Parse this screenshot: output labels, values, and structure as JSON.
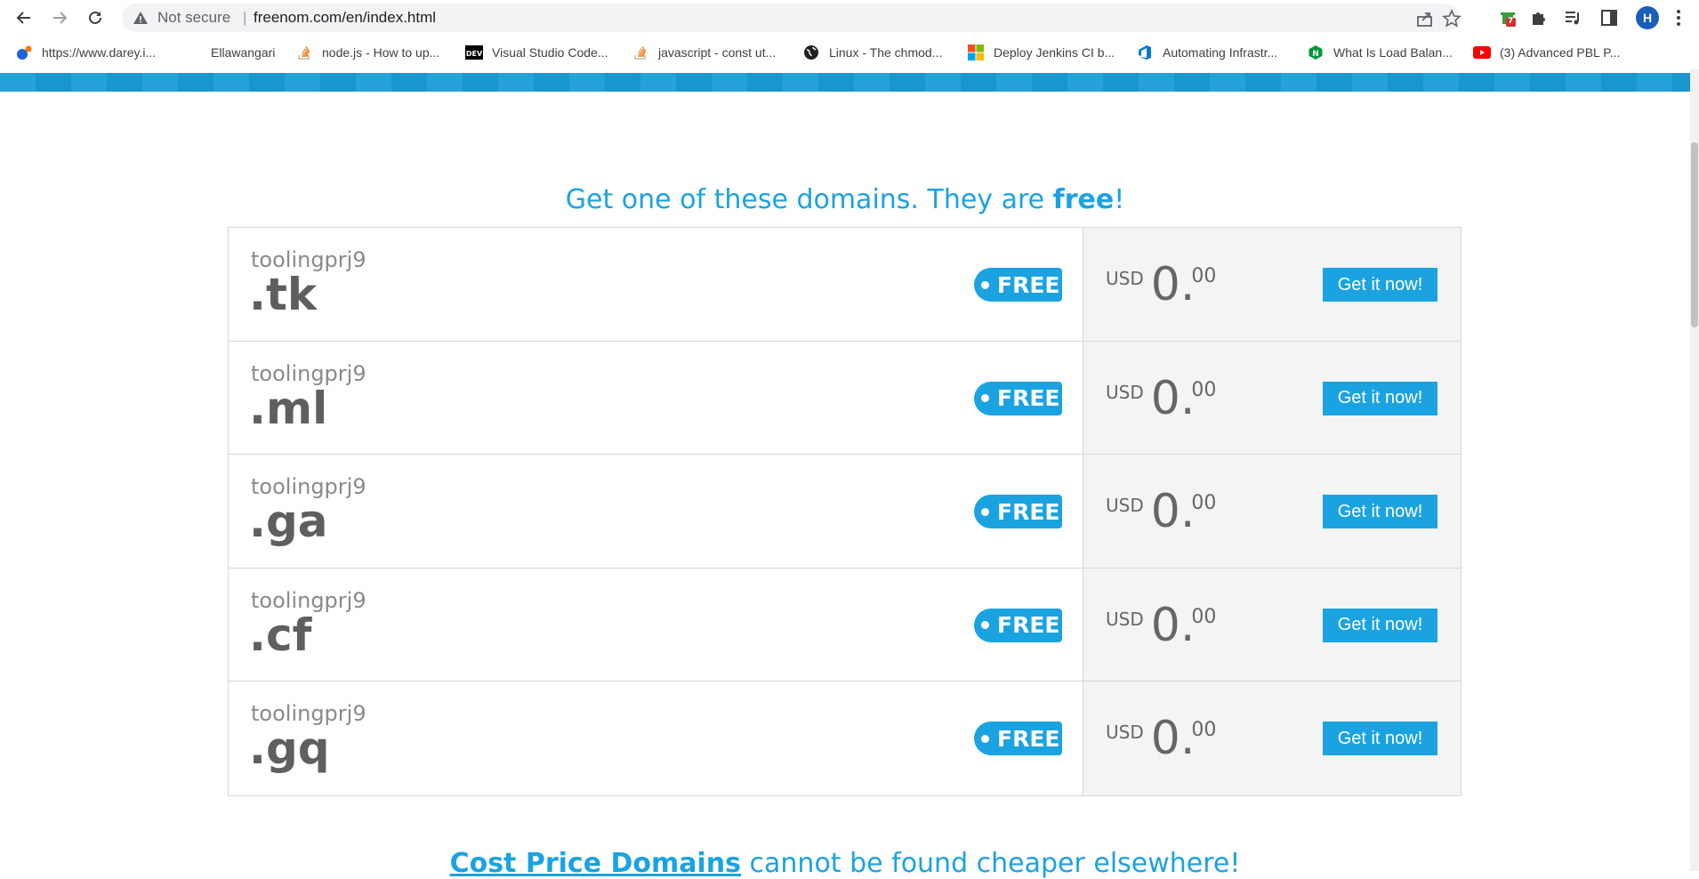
{
  "browser": {
    "security_label": "Not secure",
    "separator": "|",
    "url": "freenom.com/en/index.html",
    "avatar_letter": "H",
    "extension_badge": "7"
  },
  "bookmarks": [
    {
      "label": "https://www.darey.i...",
      "icon": "darey-icon"
    },
    {
      "label": "Ellawangari",
      "icon": "blank-icon"
    },
    {
      "label": "node.js - How to up...",
      "icon": "stackoverflow-icon"
    },
    {
      "label": "Visual Studio Code...",
      "icon": "dev-icon"
    },
    {
      "label": "javascript - const ut...",
      "icon": "stackoverflow-icon"
    },
    {
      "label": "Linux - The chmod...",
      "icon": "globe-icon"
    },
    {
      "label": "Deploy Jenkins CI b...",
      "icon": "microsoft-icon"
    },
    {
      "label": "Automating Infrastr...",
      "icon": "azure-devops-icon"
    },
    {
      "label": "What Is Load Balan...",
      "icon": "nginx-icon"
    },
    {
      "label": "(3) Advanced PBL P...",
      "icon": "youtube-icon"
    }
  ],
  "page": {
    "headline_prefix": "Get one of these domains. They are ",
    "headline_bold": "free",
    "headline_suffix": "!",
    "subline_bold": "Cost Price Domains",
    "subline_rest": " cannot be found cheaper elsewhere!"
  },
  "domains": [
    {
      "name": "toolingprj9",
      "tld": ".tk",
      "badge": "FREE",
      "currency": "USD",
      "price_int": "0.",
      "price_dec": "00",
      "button": "Get it now!"
    },
    {
      "name": "toolingprj9",
      "tld": ".ml",
      "badge": "FREE",
      "currency": "USD",
      "price_int": "0.",
      "price_dec": "00",
      "button": "Get it now!"
    },
    {
      "name": "toolingprj9",
      "tld": ".ga",
      "badge": "FREE",
      "currency": "USD",
      "price_int": "0.",
      "price_dec": "00",
      "button": "Get it now!"
    },
    {
      "name": "toolingprj9",
      "tld": ".cf",
      "badge": "FREE",
      "currency": "USD",
      "price_int": "0.",
      "price_dec": "00",
      "button": "Get it now!"
    },
    {
      "name": "toolingprj9",
      "tld": ".gq",
      "badge": "FREE",
      "currency": "USD",
      "price_int": "0.",
      "price_dec": "00",
      "button": "Get it now!"
    }
  ],
  "colors": {
    "accent": "#1aa3e0",
    "price_panel": "#f4f4f4",
    "text_muted": "#8a8a8a",
    "text_dark": "#5f5f5f"
  }
}
